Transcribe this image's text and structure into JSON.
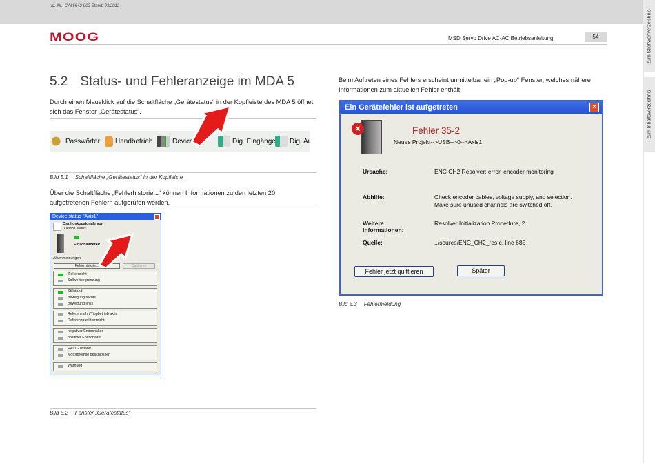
{
  "header": {
    "doc_id": "Id.-Nr.: CA65642-002 Stand: 03/2012",
    "logo": "MOOG",
    "title": "MSD Servo Drive AC-AC Betriebsanleitung",
    "page_number": "54"
  },
  "side_tabs": {
    "keyword_index": "zum Stichwortverzeichnis",
    "contents": "zum Inhaltsverzeichnis"
  },
  "section": {
    "number": "5.2",
    "title": "Status- und Fehleranzeige im MDA 5"
  },
  "paragraphs": {
    "p1": "Durch einen Mausklick auf die Schaltfläche „Gerätestatus“ in der Kopfleiste des MDA 5 öffnet sich das Fenster „Gerätestatus“.",
    "p2": "Über die Schaltfläche „Fehlerhistorie...“ können Informationen zu den letzten 20 aufgetretenen Fehlern aufgerufen werden.",
    "p3": "Beim Auftreten eines Fehlers erscheint unmittelbar ein „Pop-up“ Fenster, welches nähere Informationen zum aktuellen Fehler enthält."
  },
  "toolbar": {
    "items": [
      "Passwörter",
      "Handbetrieb",
      "Device",
      "Dig. Eingänge",
      "Dig. Au"
    ]
  },
  "captions": {
    "fig1_num": "Bild 5.1",
    "fig1_text": "Schaltfläche „Gerätestatus“ in der Kopfleiste",
    "fig2_num": "Bild 5.2",
    "fig2_text": "Fenster „Gerätestatus“",
    "fig3_num": "Bild 5.3",
    "fig3_text": "Fehlermeldung"
  },
  "device_window": {
    "title": "Device status \"Axis1\"",
    "oscillo": "Oszilloskopsignale von",
    "oscillo_sub": "Device status",
    "ready": "Einschaltbereit",
    "alarms": "Alarmmeldungen",
    "history_button": "Fehlerhistorie...",
    "quit_button": "Quittieren",
    "groups": [
      [
        "Ziel erreicht",
        "Sollwertbegrenzung"
      ],
      [
        "Stillstand",
        "Bewegung rechts",
        "Bewegung links"
      ],
      [
        "Referenzfahrt/Tippbetrieb aktiv",
        "Referenzpunkt erreicht"
      ],
      [
        "negativer Endschalter",
        "positiver Endschalter"
      ],
      [
        "HALT-Zustand",
        "Motorbremse geschlossen"
      ],
      [
        "Warnung"
      ]
    ]
  },
  "error_dialog": {
    "title": "Ein Gerätefehler ist aufgetreten",
    "error_code": "Fehler 35-2",
    "path": "Neues Projekt-->USB-->0-->Axis1",
    "cause_label": "Ursache:",
    "cause": "ENC CH2 Resolver: error, encoder monitoring",
    "remedy_label": "Abhilfe:",
    "remedy_line1": "Check encoder cables, voltage supply, and selection.",
    "remedy_line2": "Make sure unused channels are switched off.",
    "further_label_1": "Weitere",
    "further_label_2": "Informationen:",
    "further": "Resolver Initialization Procedure, 2",
    "source_label": "Quelle:",
    "source": "../source/ENC_CH2_res.c, line 685",
    "acknowledge_button": "Fehler jetzt quittieren",
    "later_button": "Später"
  },
  "colors": {
    "brand_red": "#c4122f",
    "window_blue": "#2b5fe0",
    "error_red": "#b02020",
    "led_green": "#18c018"
  }
}
